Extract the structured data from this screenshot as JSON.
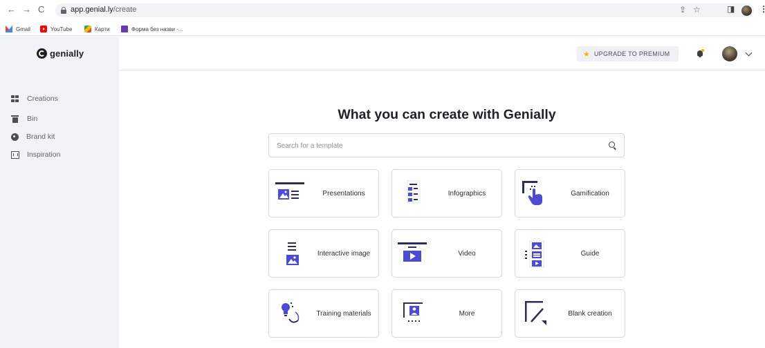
{
  "browser": {
    "url_host": "app.genial.ly",
    "url_path": "/create",
    "bookmarks": [
      "Gmail",
      "YouTube",
      "Карти",
      "Форма без назви -..."
    ]
  },
  "colors": {
    "accent": "#4b4bd4",
    "star": "#f5b400",
    "sidebar_bg": "#f1f3f6"
  },
  "sidebar": {
    "logo_text": "genially",
    "items": [
      {
        "label": "Creations",
        "icon": "grid-icon"
      },
      {
        "label": "Bin",
        "icon": "trash-icon"
      },
      {
        "label": "Brand kit",
        "icon": "palette-icon"
      },
      {
        "label": "Inspiration",
        "icon": "picture-frame-icon"
      }
    ]
  },
  "header": {
    "upgrade_label": "UPGRADE TO PREMIUM"
  },
  "main": {
    "title": "What you can create with Genially",
    "search_placeholder": "Search for a template",
    "cards": [
      {
        "label": "Presentations",
        "icon": "presentation-icon"
      },
      {
        "label": "Infographics",
        "icon": "infographic-icon"
      },
      {
        "label": "Gamification",
        "icon": "gamification-icon"
      },
      {
        "label": "Interactive image",
        "icon": "interactive-image-icon"
      },
      {
        "label": "Video",
        "icon": "video-icon"
      },
      {
        "label": "Guide",
        "icon": "guide-icon"
      },
      {
        "label": "Training materials",
        "icon": "training-icon"
      },
      {
        "label": "More",
        "icon": "more-icon"
      },
      {
        "label": "Blank creation",
        "icon": "blank-creation-icon"
      }
    ]
  }
}
